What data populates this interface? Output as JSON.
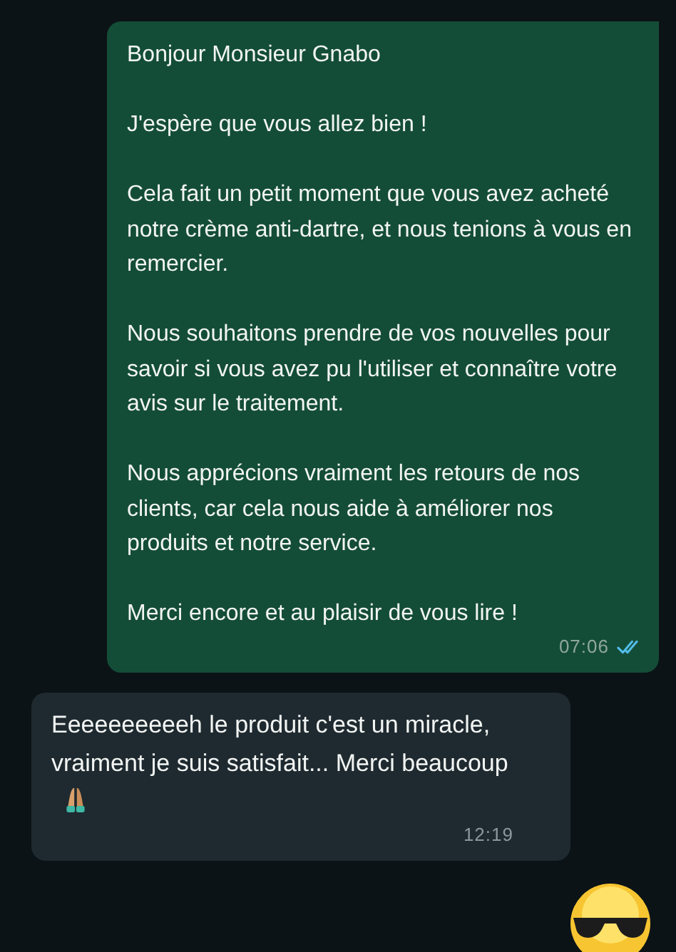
{
  "messages": [
    {
      "kind": "sent",
      "paragraphs": [
        "Bonjour Monsieur Gnabo",
        "J'espère que vous allez bien !",
        "Cela fait un petit moment que vous avez acheté notre crème anti-dartre, et nous tenions à vous en remercier.",
        "Nous souhaitons prendre de vos nouvelles pour savoir si vous avez pu l'utiliser et connaître votre avis sur le traitement.",
        "Nous apprécions vraiment les retours de nos clients, car cela nous aide à améliorer nos produits et notre service.",
        "Merci encore et au plaisir de vous lire !"
      ],
      "time": "07:06",
      "read": true
    },
    {
      "kind": "received",
      "paragraphs": [
        "Eeeeeeeeeeh le produit c'est un miracle, vraiment je suis satisfait... Merci beaucoup"
      ],
      "trailing_icon": true,
      "time": "12:19"
    },
    {
      "kind": "emoji"
    }
  ]
}
